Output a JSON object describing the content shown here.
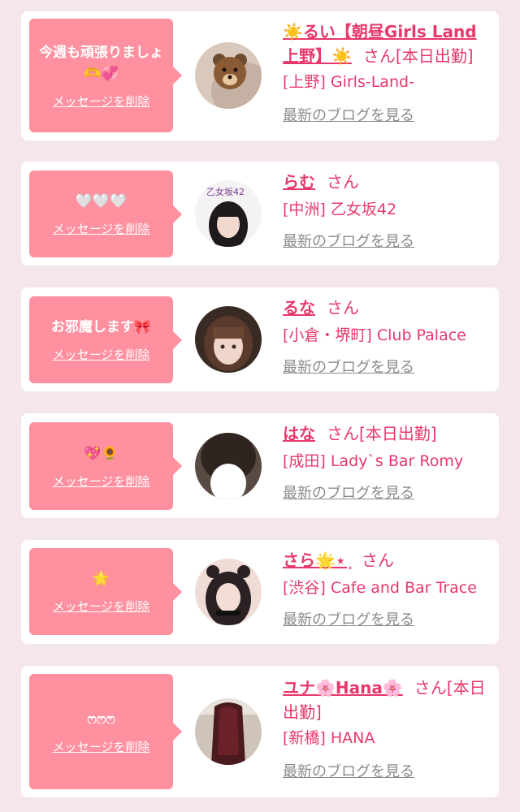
{
  "cards": [
    {
      "message": "今週も頑張りましょ🫶💞",
      "delete_label": "メッセージを削除",
      "name": "☀️るい【朝昼Girls Land上野】☀️",
      "suffix": "さん[本日出勤]",
      "shop": "[上野] Girls-Land-",
      "blog_label": "最新のブログを見る",
      "avatar_icon": "bear-face-photo"
    },
    {
      "message": "🤍🤍🤍",
      "delete_label": "メッセージを削除",
      "name": "らむ",
      "suffix": "さん",
      "shop": "[中洲] 乙女坂42",
      "blog_label": "最新のブログを見る",
      "avatar_icon": "girl-photo"
    },
    {
      "message": "お邪魔します🎀",
      "delete_label": "メッセージを削除",
      "name": "るな",
      "suffix": "さん",
      "shop": "[小倉・堺町] Club Palace",
      "blog_label": "最新のブログを見る",
      "avatar_icon": "girl-photo"
    },
    {
      "message": "💖🌻",
      "delete_label": "メッセージを削除",
      "name": "はな",
      "suffix": "さん[本日出勤]",
      "shop": "[成田] Lady`s Bar Romy",
      "blog_label": "最新のブログを見る",
      "avatar_icon": "hair-photo"
    },
    {
      "message": "🌟",
      "delete_label": "メッセージを削除",
      "name": "さら🌟⋆ ͙",
      "suffix": "さん",
      "shop": "[渋谷] Cafe and Bar Trace",
      "blog_label": "最新のブログを見る",
      "avatar_icon": "girl-photo"
    },
    {
      "message": "ෆෆෆ",
      "delete_label": "メッセージを削除",
      "name": "ユナ🌸Hana🌸",
      "suffix": "さん[本日出勤]",
      "shop": "[新橋] HANA",
      "blog_label": "最新のブログを見る",
      "avatar_icon": "long-hair-photo"
    }
  ]
}
